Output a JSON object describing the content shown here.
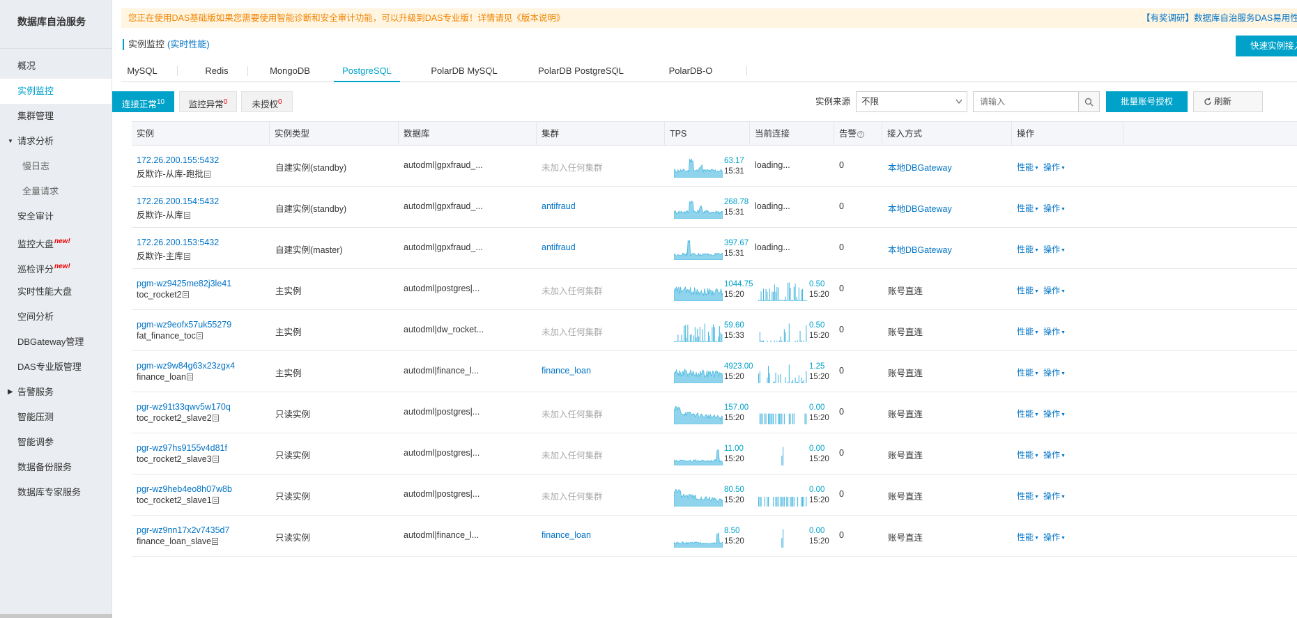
{
  "sidebar": {
    "title": "数据库自治服务",
    "items": [
      {
        "label": "概况",
        "active": false,
        "sub": false,
        "group": false,
        "new": false
      },
      {
        "label": "实例监控",
        "active": true,
        "sub": false,
        "group": false,
        "new": false
      },
      {
        "label": "集群管理",
        "active": false,
        "sub": false,
        "group": false,
        "new": false
      },
      {
        "label": "请求分析",
        "active": false,
        "sub": false,
        "group": "open",
        "new": false
      },
      {
        "label": "慢日志",
        "active": false,
        "sub": true,
        "group": false,
        "new": false
      },
      {
        "label": "全量请求",
        "active": false,
        "sub": true,
        "group": false,
        "new": false
      },
      {
        "label": "安全审计",
        "active": false,
        "sub": false,
        "group": false,
        "new": false
      },
      {
        "label": "监控大盘",
        "active": false,
        "sub": false,
        "group": false,
        "new": true
      },
      {
        "label": "巡检评分",
        "active": false,
        "sub": false,
        "group": false,
        "new": true
      },
      {
        "label": "实时性能大盘",
        "active": false,
        "sub": false,
        "group": false,
        "new": false
      },
      {
        "label": "空间分析",
        "active": false,
        "sub": false,
        "group": false,
        "new": false
      },
      {
        "label": "DBGateway管理",
        "active": false,
        "sub": false,
        "group": false,
        "new": false
      },
      {
        "label": "DAS专业版管理",
        "active": false,
        "sub": false,
        "group": false,
        "new": false
      },
      {
        "label": "告警服务",
        "active": false,
        "sub": false,
        "group": "closed",
        "new": false
      },
      {
        "label": "智能压测",
        "active": false,
        "sub": false,
        "group": false,
        "new": false
      },
      {
        "label": "智能调参",
        "active": false,
        "sub": false,
        "group": false,
        "new": false
      },
      {
        "label": "数据备份服务",
        "active": false,
        "sub": false,
        "group": false,
        "new": false
      },
      {
        "label": "数据库专家服务",
        "active": false,
        "sub": false,
        "group": false,
        "new": false
      }
    ],
    "new_badge": "new!"
  },
  "notice": {
    "text": "您正在使用DAS基础版如果您需要使用智能诊断和安全审计功能，可以升级到DAS专业版！详情请见《版本说明》",
    "right": "【有奖调研】数据库自治服务DAS易用性调"
  },
  "breadcrumb": {
    "title": "实例监控",
    "sub": "(实时性能)"
  },
  "quick_button": "快速实例接入",
  "tabs": [
    "MySQL",
    "Redis",
    "MongoDB",
    "PostgreSQL",
    "PolarDB MySQL",
    "PolarDB PostgreSQL",
    "PolarDB-O"
  ],
  "active_tab": "PostgreSQL",
  "toolbar": {
    "status": [
      {
        "label": "连接正常",
        "count": "10",
        "active": true
      },
      {
        "label": "监控异常",
        "count": "0",
        "active": false
      },
      {
        "label": "未授权",
        "count": "0",
        "active": false
      }
    ],
    "source_label": "实例来源",
    "source_value": "不限",
    "search_placeholder": "请输入",
    "batch_button": "批量账号授权",
    "refresh_button": "刷新"
  },
  "table": {
    "columns": [
      "实例",
      "实例类型",
      "数据库",
      "集群",
      "TPS",
      "当前连接",
      "告警",
      "接入方式",
      "操作"
    ],
    "op_perf": "性能",
    "op_action": "操作",
    "rows": [
      {
        "id": "172.26.200.155:5432",
        "name": "反欺诈-从库-跑批",
        "type": "自建实例(standby)",
        "db": "autodml|gpxfraud_...",
        "cluster": "未加入任何集群",
        "cluster_link": false,
        "tps": "63.17",
        "tps_time": "15:31",
        "tps_shape": "spiky",
        "conn": "loading...",
        "conn_val": null,
        "conn_time": null,
        "conn_shape": null,
        "alert": "0",
        "access": "本地DBGateway",
        "access_link": true
      },
      {
        "id": "172.26.200.154:5432",
        "name": "反欺诈-从库",
        "type": "自建实例(standby)",
        "db": "autodml|gpxfraud_...",
        "cluster": "antifraud",
        "cluster_link": true,
        "tps": "268.78",
        "tps_time": "15:31",
        "tps_shape": "spiky",
        "conn": "loading...",
        "conn_val": null,
        "conn_time": null,
        "conn_shape": null,
        "alert": "0",
        "access": "本地DBGateway",
        "access_link": true
      },
      {
        "id": "172.26.200.153:5432",
        "name": "反欺诈-主库",
        "type": "自建实例(master)",
        "db": "autodml|gpxfraud_...",
        "cluster": "antifraud",
        "cluster_link": true,
        "tps": "397.67",
        "tps_time": "15:31",
        "tps_shape": "peak",
        "conn": "loading...",
        "conn_val": null,
        "conn_time": null,
        "conn_shape": null,
        "alert": "0",
        "access": "本地DBGateway",
        "access_link": true
      },
      {
        "id": "pgm-wz9425me82j3le41",
        "name": "toc_rocket2",
        "type": "主实例",
        "db": "autodml|postgres|...",
        "cluster": "未加入任何集群",
        "cluster_link": false,
        "tps": "1044.75",
        "tps_time": "15:20",
        "tps_shape": "dense",
        "conn": null,
        "conn_val": "0.50",
        "conn_time": "15:20",
        "conn_shape": "bars",
        "alert": "0",
        "access": "账号直连",
        "access_link": false
      },
      {
        "id": "pgm-wz9eofx57uk55279",
        "name": "fat_finance_toc",
        "type": "主实例",
        "db": "autodml|dw_rocket...",
        "cluster": "未加入任何集群",
        "cluster_link": false,
        "tps": "59.60",
        "tps_time": "15:33",
        "tps_shape": "bars",
        "conn": null,
        "conn_val": "0.50",
        "conn_time": "15:20",
        "conn_shape": "sparse",
        "alert": "0",
        "access": "账号直连",
        "access_link": false
      },
      {
        "id": "pgm-wz9w84g63x23zgx4",
        "name": "finance_loan",
        "type": "主实例",
        "db": "autodml|finance_l...",
        "cluster": "finance_loan",
        "cluster_link": true,
        "tps": "4923.00",
        "tps_time": "15:20",
        "tps_shape": "dense",
        "conn": null,
        "conn_val": "1.25",
        "conn_time": "15:20",
        "conn_shape": "sparse",
        "alert": "0",
        "access": "账号直连",
        "access_link": false
      },
      {
        "id": "pgr-wz91t33qwv5w170q",
        "name": "toc_rocket2_slave2",
        "type": "只读实例",
        "db": "autodml|postgres|...",
        "cluster": "未加入任何集群",
        "cluster_link": false,
        "tps": "157.00",
        "tps_time": "15:20",
        "tps_shape": "decay",
        "conn": null,
        "conn_val": "0.00",
        "conn_time": "15:20",
        "conn_shape": "blocks",
        "alert": "0",
        "access": "账号直连",
        "access_link": false
      },
      {
        "id": "pgr-wz97hs9155v4d81f",
        "name": "toc_rocket2_slave3",
        "type": "只读实例",
        "db": "autodml|postgres|...",
        "cluster": "未加入任何集群",
        "cluster_link": false,
        "tps": "11.00",
        "tps_time": "15:20",
        "tps_shape": "flat",
        "conn": null,
        "conn_val": "0.00",
        "conn_time": "15:20",
        "conn_shape": "single",
        "alert": "0",
        "access": "账号直连",
        "access_link": false
      },
      {
        "id": "pgr-wz9heb4eo8h07w8b",
        "name": "toc_rocket2_slave1",
        "type": "只读实例",
        "db": "autodml|postgres|...",
        "cluster": "未加入任何集群",
        "cluster_link": false,
        "tps": "80.50",
        "tps_time": "15:20",
        "tps_shape": "decay",
        "conn": null,
        "conn_val": "0.00",
        "conn_time": "15:20",
        "conn_shape": "blocks2",
        "alert": "0",
        "access": "账号直连",
        "access_link": false
      },
      {
        "id": "pgr-wz9nn17x2v7435d7",
        "name": "finance_loan_slave",
        "type": "只读实例",
        "db": "autodml|finance_l...",
        "cluster": "finance_loan",
        "cluster_link": true,
        "tps": "8.50",
        "tps_time": "15:20",
        "tps_shape": "flat",
        "conn": null,
        "conn_val": "0.00",
        "conn_time": "15:20",
        "conn_shape": "single",
        "alert": "0",
        "access": "账号直连",
        "access_link": false
      }
    ]
  },
  "colors": {
    "accent": "#00a2ca",
    "link": "#0073c7",
    "notice": "#f08300",
    "spark_fill": "#8fd4ec",
    "spark_line": "#4ab8e0"
  },
  "icons": [
    "search-icon",
    "refresh-icon",
    "doc-icon",
    "chevron-down-icon",
    "caret-icon"
  ]
}
